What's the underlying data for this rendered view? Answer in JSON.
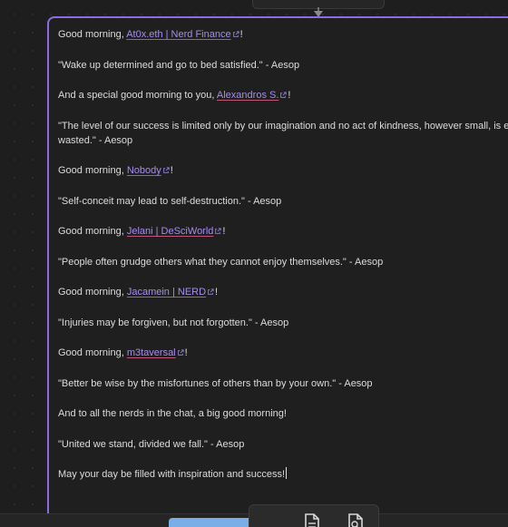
{
  "colors": {
    "accent_border": "#8e6be0",
    "mention_text": "#a58cf0",
    "mention_underline": "#c0557a",
    "body_text": "#dcdcdc",
    "background": "#1e1e1e"
  },
  "card": {
    "paragraphs": [
      {
        "pre": "Good morning, ",
        "mention": "At0x.eth | Nerd Finance",
        "post": "!"
      },
      {
        "text": "\"Wake up determined and go to bed satisfied.\" - Aesop"
      },
      {
        "pre": "And a special good morning to you, ",
        "mention": "Alexandros S.",
        "post": "!"
      },
      {
        "text": "\"The level of our success is limited only by our imagination and no act of kindness, however small, is ever wasted.\" - Aesop"
      },
      {
        "pre": "Good morning, ",
        "mention": "Nobody",
        "post": "!"
      },
      {
        "text": "\"Self-conceit may lead to self-destruction.\" - Aesop"
      },
      {
        "pre": "Good morning, ",
        "mention": "Jelani | DeSciWorld",
        "post": "!"
      },
      {
        "text": "\"People often grudge others what they cannot enjoy themselves.\" - Aesop"
      },
      {
        "pre": "Good morning, ",
        "mention": "Jacamein | NERD",
        "post": "!"
      },
      {
        "text": "\"Injuries may be forgiven, but not forgotten.\" - Aesop"
      },
      {
        "pre": "Good morning, ",
        "mention": "m3taversal",
        "post": "!"
      },
      {
        "text": "\"Better be wise by the misfortunes of others than by your own.\" - Aesop"
      },
      {
        "text": "And to all the nerds in the chat, a big good morning!"
      },
      {
        "text": "\"United we stand, divided we fall.\" - Aesop"
      },
      {
        "text": "May your day be filled with inspiration and success!",
        "caret": true
      }
    ]
  },
  "toolbar": {
    "icons": [
      "document-icon",
      "search-document-icon"
    ]
  }
}
